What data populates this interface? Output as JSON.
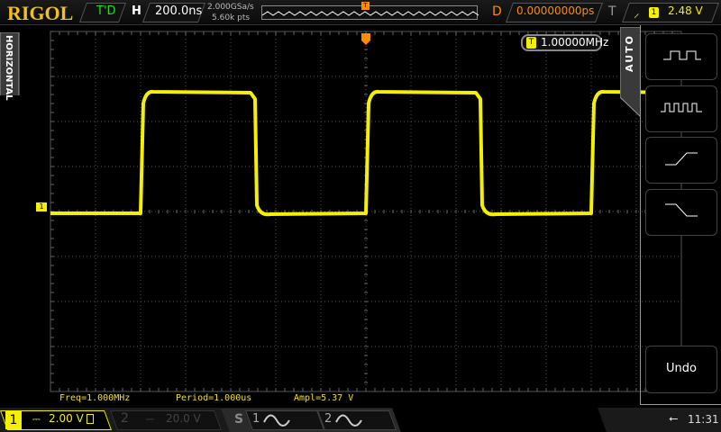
{
  "header": {
    "brand": "RIGOL",
    "run_state": "T'D",
    "timebase_label": "H",
    "timebase": "200.0ns",
    "sample_rate": "2.000GSa/s",
    "memory_depth": "5.60k pts",
    "delay_label": "D",
    "delay": "0.00000000ps",
    "trigger_label": "T",
    "trigger_source": "1",
    "trigger_level": "2.48 V",
    "trigger_edge_icon": "rising-edge-icon"
  },
  "side_tab": "HORIZONTAL",
  "freq_counter": {
    "badge": "T",
    "value": "1.00000MHz"
  },
  "menu": {
    "title": "AUTO",
    "buttons": [
      {
        "icon": "multi-period-icon"
      },
      {
        "icon": "single-period-icon"
      },
      {
        "icon": "rising-edge-icon"
      },
      {
        "icon": "falling-edge-icon"
      }
    ],
    "undo": "Undo"
  },
  "channel_marker": "1",
  "measurements": [
    "Freq=1.000MHz",
    "Period=1.000us",
    "Ampl=5.37 V"
  ],
  "bottom": {
    "ch1_num": "1",
    "ch1_scale": "2.00 V",
    "ch1_coupling": "⎓",
    "ch2_num": "2",
    "ch2_scale": "20.0 V",
    "ch2_coupling": "⎓",
    "sig_label": "S",
    "sig1": "1",
    "sig2": "2",
    "time": "11:31"
  },
  "colors": {
    "ch1": "#f5f000",
    "brand": "#f0c020",
    "trigger": "#ff8c00",
    "run": "#22dd22"
  }
}
